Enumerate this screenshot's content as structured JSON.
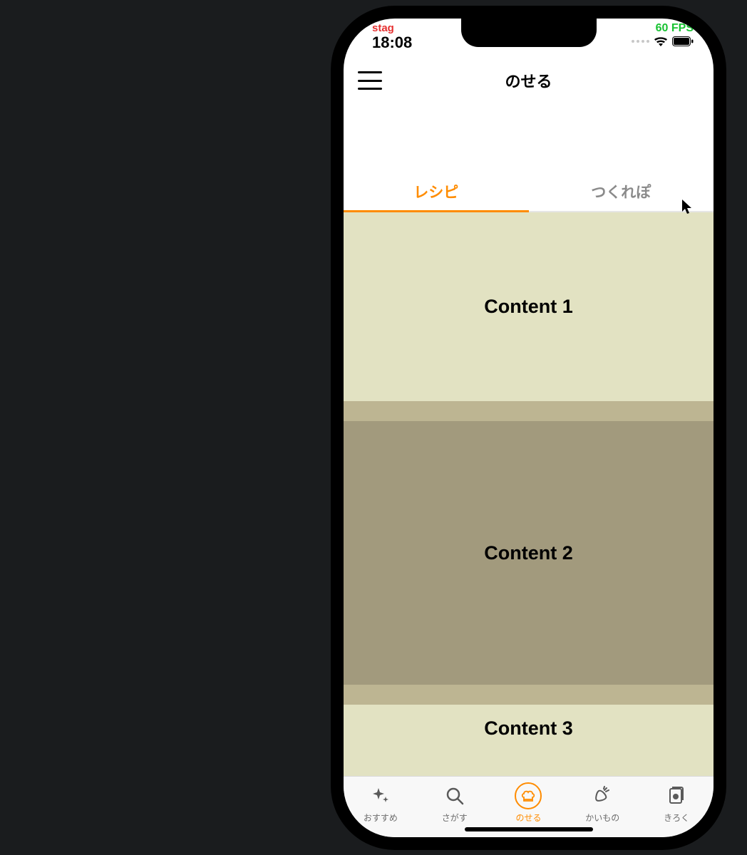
{
  "statusbar": {
    "stag": "stag",
    "time": "18:08",
    "fps": "60 FPS"
  },
  "header": {
    "title": "のせる"
  },
  "tabs": [
    {
      "label": "レシピ",
      "active": true
    },
    {
      "label": "つくれぽ",
      "active": false
    }
  ],
  "content": [
    {
      "label": "Content 1"
    },
    {
      "label": "Content 2"
    },
    {
      "label": "Content 3"
    }
  ],
  "bottom": [
    {
      "label": "おすすめ",
      "icon": "sparkle-icon",
      "active": false
    },
    {
      "label": "さがす",
      "icon": "search-icon",
      "active": false
    },
    {
      "label": "のせる",
      "icon": "chef-hat-icon",
      "active": true
    },
    {
      "label": "かいもの",
      "icon": "carrot-icon",
      "active": false
    },
    {
      "label": "きろく",
      "icon": "card-icon",
      "active": false
    }
  ],
  "colors": {
    "accent": "#ff8c00"
  }
}
